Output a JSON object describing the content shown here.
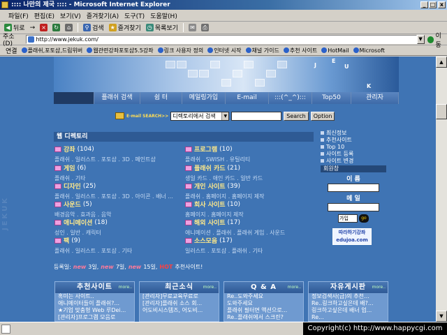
{
  "window": {
    "title": ":::: 나만의 제국 :::: - Microsoft Internet Explorer",
    "buttons": [
      "_",
      "□",
      "x"
    ]
  },
  "menu": [
    "파일(F)",
    "편집(E)",
    "보기(V)",
    "즐겨찾기(A)",
    "도구(T)",
    "도움말(H)"
  ],
  "toolbar": {
    "back": "뒤로",
    "forward": "→",
    "search": "검색",
    "favorites": "즐겨찾기",
    "history": "목록보기"
  },
  "address": {
    "label": "주소(D)",
    "url": "http://www.jekuk.com/",
    "go": "이동"
  },
  "links": {
    "label": "연결",
    "items": [
      "플래쉬,포토샵,드림위버",
      "웹관련강좌포토샵5.5강좌",
      "링크 사용자 정의",
      "인터넷 시작",
      "채널 가이드",
      "추천 사이트",
      "HotMail",
      "Microsoft"
    ]
  },
  "banner": {
    "letters": [
      "J",
      "E",
      "U",
      "K"
    ]
  },
  "nav": [
    "플래쉬 검색",
    "쉼 터",
    "메일링가입",
    "E-mail",
    ":::(^_^):::",
    "Top50",
    "관리자"
  ],
  "search": {
    "label": "E-mail SEARCH>>",
    "select": "디렉토리에서 검색",
    "button": "Search",
    "option": "Option"
  },
  "directory": {
    "title": "웹 디렉토리",
    "categories": [
      {
        "name": "강좌",
        "count": "(104)",
        "sub": "플래쉬 . 일러스트 . 포토샵 . 3D . 페인트샵"
      },
      {
        "name": "프로그램",
        "count": "(10)",
        "sub": "플래쉬 . SWISH . 유틸리티"
      },
      {
        "name": "게임",
        "count": "(6)",
        "sub": "플래쉬 . 기타"
      },
      {
        "name": "플래쉬 카드",
        "count": "(21)",
        "sub": "생일 카드 . 애인 카드 . 일반 카드"
      },
      {
        "name": "디자인",
        "count": "(25)",
        "sub": "플래쉬 . 일러스트 . 포토샵 . 3D . 아이콘 . 배너 ..."
      },
      {
        "name": "개인 사이트",
        "count": "(39)",
        "sub": "플래쉬 . 홈페이지 . 홈페이지 제작"
      },
      {
        "name": "사운드",
        "count": "(5)",
        "sub": "배경음악 . 효과음 . 음악"
      },
      {
        "name": "회사 사이트",
        "count": "(10)",
        "sub": "홈페이지 . 홈페이지 제작"
      },
      {
        "name": "애니메이션",
        "count": "(18)",
        "sub": "성인 . 일반 . 캐릭터"
      },
      {
        "name": "해외 사이트",
        "count": "(17)",
        "sub": "애니메이션 . 플래쉬 . 플래쉬 게임 . 사운드"
      },
      {
        "name": "팩",
        "count": "(9)",
        "sub": "플래쉬 . 일러스트 . 포토샵 . 기타"
      },
      {
        "name": "소스모음",
        "count": "(17)",
        "sub": "일러스트 . 포토샵 . 플래쉬 . 기타"
      }
    ]
  },
  "registration": {
    "prefix": "등록일:",
    "new1": "new",
    "days1": "3일,",
    "new2": "new",
    "days2": "7일,",
    "new3": "new",
    "days3": "15일,",
    "hot": "HOT",
    "suffix": "추천사이트!"
  },
  "right": {
    "items": [
      "최신정보",
      "추천사이트",
      "Top 10",
      "사이트 등록",
      "사이트 변경"
    ],
    "member": "회원창",
    "id_label": "이 름",
    "pw_label": "메 일",
    "join": "가입",
    "go": "go",
    "partner": "따라하기강좌 edujoa.com"
  },
  "boxes": [
    {
      "title": "추천사이트",
      "more": "more..",
      "lines": [
        "혹미는 사이트..",
        "애니메이터들이 플래쉬?...",
        "★기업 맞춤형 Web 루Dei...",
        "[관리자]프로그램 모음로"
      ]
    },
    {
      "title": "최근소식",
      "more": "more..",
      "lines": [
        "",
        "[관리자]무료교육무료로",
        "[관리자]플래쉬 소스 회...",
        "어도비시스템즈, 어도비..."
      ]
    },
    {
      "title": "Q & A",
      "more": "more..",
      "lines": [
        "Re..도와주세요",
        "도와주세요",
        "플래쉬 필터면 액션으로...",
        "Re..플래쉬에서 스크린?"
      ]
    },
    {
      "title": "자유게시판",
      "more": "more..",
      "lines": [
        "정보검색사(급)의 추천...",
        "Re..링크하고싶은데 배?...",
        "링크하고싶은데 배너 업...",
        "Re..."
      ]
    }
  ],
  "watermark": "JEKUK",
  "copyright": "Copyright(c) http://www.happycgi.com"
}
